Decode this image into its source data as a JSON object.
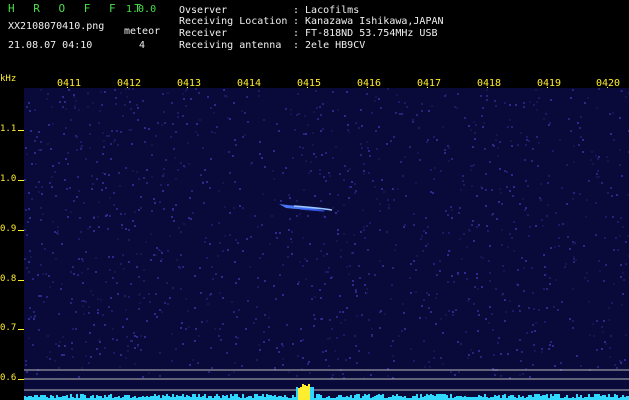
{
  "header": {
    "logo": "H R O F F T",
    "version": "1.0.0",
    "filename": "XX2108070410.png",
    "datetime": "21.08.07 04:10",
    "count_label": "meteor",
    "count_value": "4",
    "fields": [
      {
        "label": "Ovserver",
        "value": ": Lacofilms"
      },
      {
        "label": "Receiving Location",
        "value": ": Kanazawa Ishikawa,JAPAN"
      },
      {
        "label": "Receiver",
        "value": ": FT-818ND 53.754MHz USB"
      },
      {
        "label": "Receiving antenna",
        "value": ": 2ele HB9CV"
      }
    ]
  },
  "spectrogram": {
    "y_unit": "kHz",
    "y_ticks": [
      "1.1",
      "1.0",
      "0.9",
      "0.8",
      "0.7",
      "0.6"
    ],
    "x_ticks": [
      "0411",
      "0412",
      "0413",
      "0414",
      "0415",
      "0416",
      "0417",
      "0418",
      "0419",
      "0420"
    ],
    "colors": {
      "background": "#0a0a3a",
      "noise": "#2a2a8a",
      "echo": "#6aa0ff",
      "baseline": "#30e0ff",
      "axis": "#ffee30"
    }
  }
}
